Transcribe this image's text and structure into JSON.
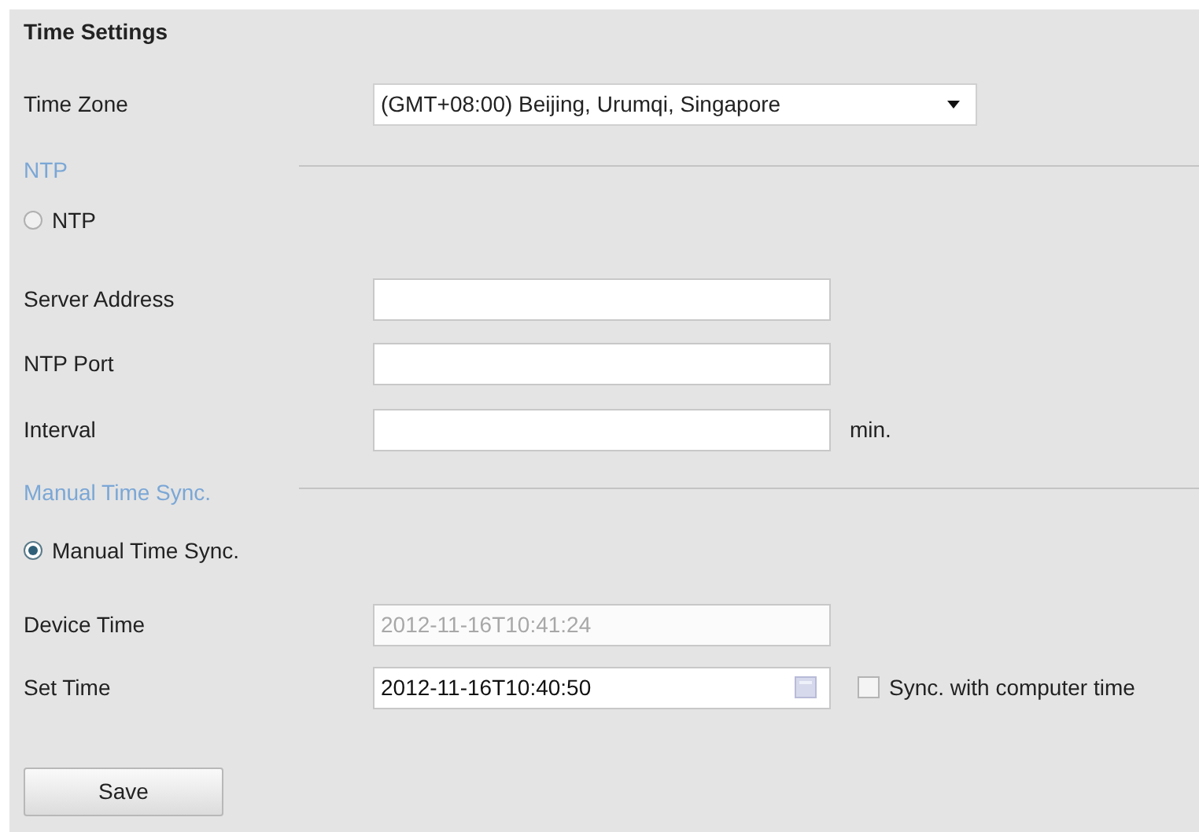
{
  "panel": {
    "title": "Time Settings"
  },
  "time_zone": {
    "label": "Time Zone",
    "value": "(GMT+08:00) Beijing, Urumqi, Singapore"
  },
  "ntp_section": {
    "heading": "NTP",
    "radio": {
      "label": "NTP",
      "selected": false
    },
    "fields": [
      {
        "label": "Server Address"
      },
      {
        "label": "NTP Port"
      },
      {
        "label": "Interval",
        "unit": "min."
      }
    ]
  },
  "manual_section": {
    "heading": "Manual Time Sync.",
    "radio": {
      "label": "Manual Time Sync.",
      "selected": true
    },
    "device_time": {
      "label": "Device Time",
      "value": "2012-11-16T10:41:24",
      "disabled": true
    },
    "set_time": {
      "label": "Set Time",
      "value": "2012-11-16T10:40:50"
    },
    "sync_checkbox": {
      "label": "Sync. with computer time",
      "checked": false
    }
  },
  "buttons": [
    {
      "label": "Save"
    }
  ]
}
